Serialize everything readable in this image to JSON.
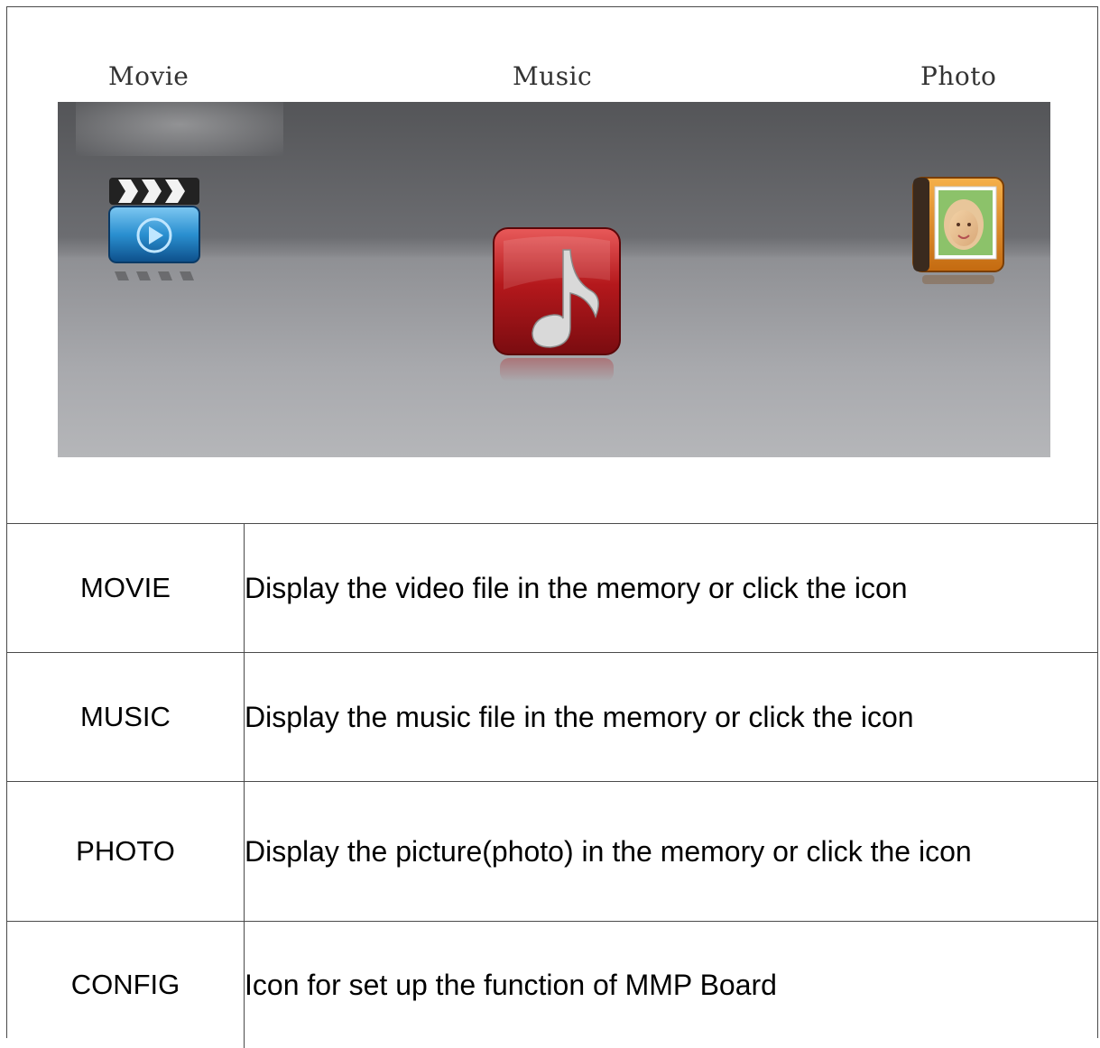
{
  "menu": {
    "labels": {
      "movie": "Movie",
      "music": "Music",
      "photo": "Photo"
    },
    "icons": [
      "clapperboard-icon",
      "music-note-icon",
      "photo-album-icon"
    ],
    "selected": "Music"
  },
  "table": {
    "rows": [
      {
        "key": "MOVIE",
        "desc": "Display the video file  in the memory or click the icon"
      },
      {
        "key": "MUSIC",
        "desc": "Display the music file in the memory or click the icon"
      },
      {
        "key": "PHOTO",
        "desc": "Display the picture(photo) in the memory or click the icon"
      },
      {
        "key": "CONFIG",
        "desc": "Icon for set up the function of MMP Board"
      }
    ]
  },
  "colors": {
    "music_icon": "#b4181c",
    "movie_icon": "#1e7fc2",
    "photo_icon": "#e08a1e"
  }
}
